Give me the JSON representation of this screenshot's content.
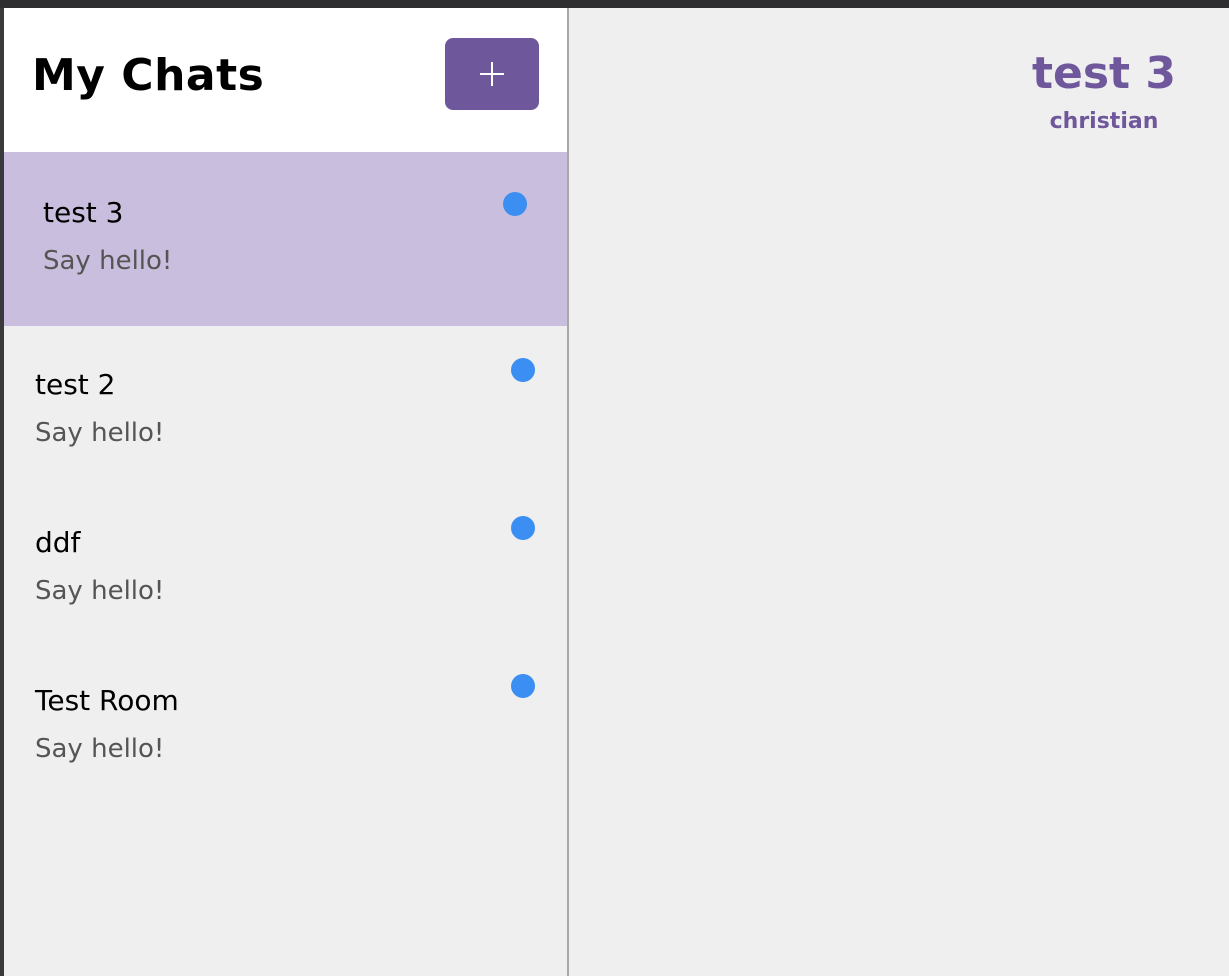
{
  "sidebar": {
    "title": "My Chats",
    "add_button_icon": "plus-icon",
    "chats": [
      {
        "title": "test 3",
        "subtitle": "Say hello!",
        "active": true
      },
      {
        "title": "test 2",
        "subtitle": "Say hello!",
        "active": false
      },
      {
        "title": "ddf",
        "subtitle": "Say hello!",
        "active": false
      },
      {
        "title": "Test Room",
        "subtitle": "Say hello!",
        "active": false
      }
    ]
  },
  "main": {
    "chat_title": "test 3",
    "chat_user": "christian"
  },
  "colors": {
    "accent": "#6f579c",
    "active_row": "#c9bedd",
    "unread_dot": "#3b8ff2",
    "background": "#efefef"
  }
}
